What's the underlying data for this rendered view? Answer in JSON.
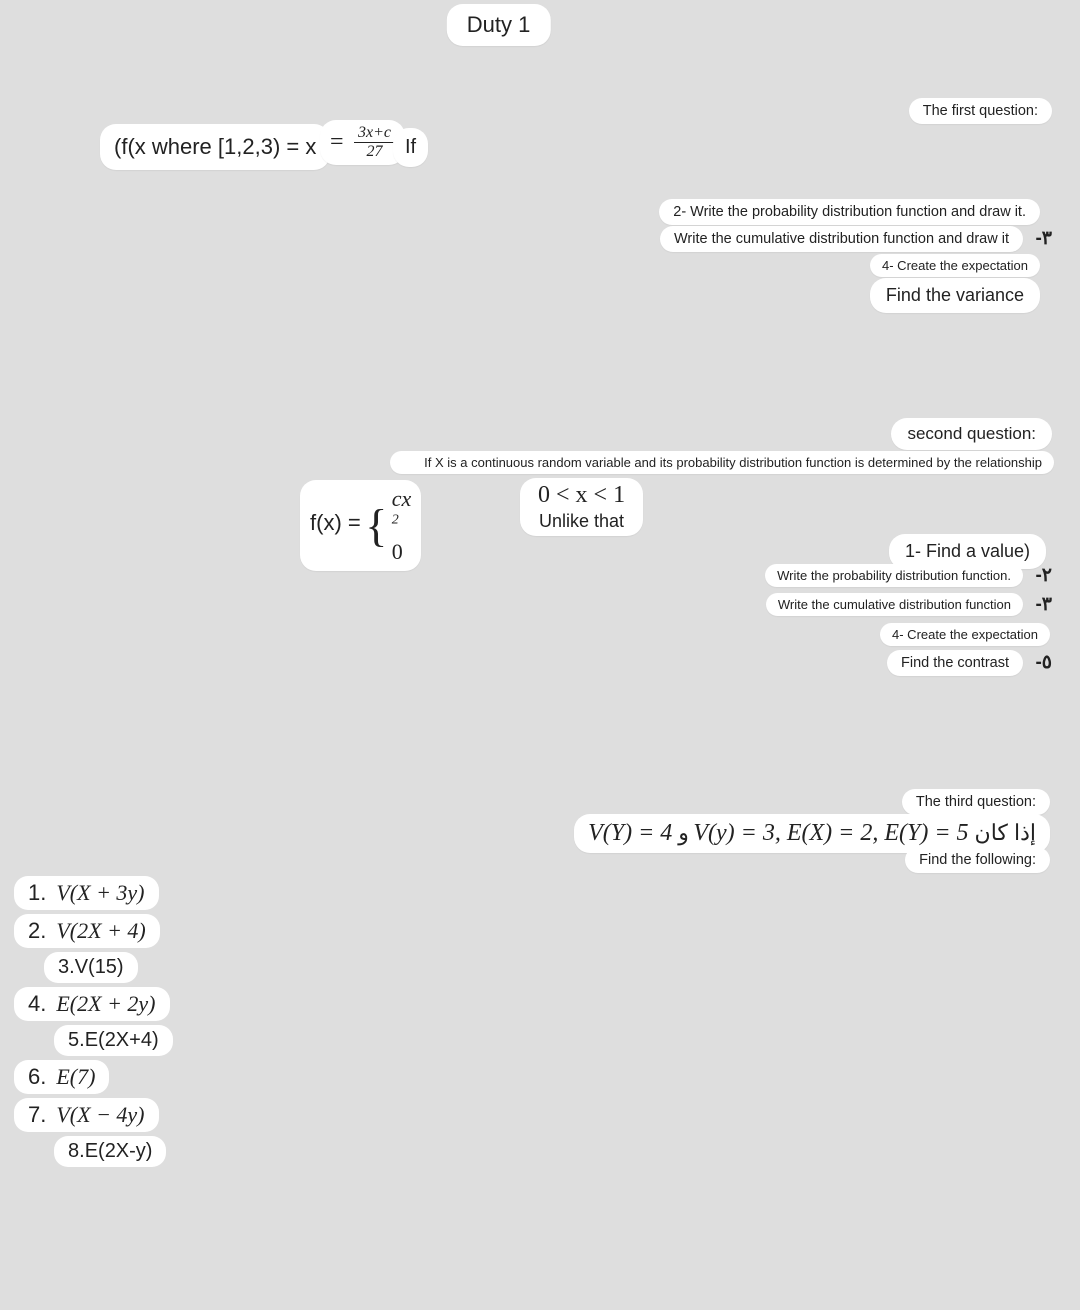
{
  "title": "Duty 1",
  "q1": {
    "heading": "The first question:",
    "formula_lhs": "(f(x where [1,2,3) = x",
    "formula_num": "3x+c",
    "formula_den": "27",
    "formula_if": "If",
    "item2": "2- Write the probability distribution function and draw it.",
    "item3_text": "Write the cumulative distribution function and draw it",
    "item3_num": "-٣",
    "item4": "4- Create the expectation",
    "item5": "Find the variance"
  },
  "q2": {
    "heading": "second question:",
    "intro": "If X is a continuous random variable and its probability distribution function is determined by the relationship",
    "fx_lhs": "f(x) =",
    "brace_top": "cx",
    "brace_top_exp": "2",
    "brace_bot": "0",
    "interval": "0 < x < 1",
    "otherwise": "Unlike that",
    "item1": "1- Find a value)",
    "item2_text": "Write the probability distribution function.",
    "item2_num": "-٢",
    "item3_text": "Write the cumulative distribution function",
    "item3_num": "-٣",
    "item4": "4- Create the expectation",
    "item5_text": "Find the contrast",
    "item5_num": "-٥"
  },
  "q3": {
    "heading": "The third question:",
    "given": "إذا كان 5 = V(Y) = 4 و V(y) = 3, E(X) = 2, E(Y)",
    "find": "Find the following:",
    "items": [
      "V(X + 3y)",
      "V(2X + 4)",
      "V(15)",
      "E(2X + 2y)",
      "E(2X+4)",
      "E(7)",
      "V(X − 4y)",
      "E(2X-y)"
    ]
  }
}
